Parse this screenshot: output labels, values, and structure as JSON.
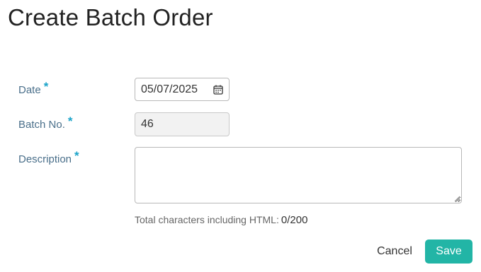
{
  "page": {
    "title": "Create Batch Order"
  },
  "form": {
    "date": {
      "label": "Date",
      "required_marker": "*",
      "value": "05/07/2025",
      "icon": "calendar-icon"
    },
    "batch_no": {
      "label": "Batch No.",
      "required_marker": "*",
      "value": "46"
    },
    "description": {
      "label": "Description",
      "required_marker": "*",
      "value": "",
      "counter_label": "Total characters including HTML:",
      "counter_value": "0/200"
    }
  },
  "actions": {
    "cancel_label": "Cancel",
    "save_label": "Save"
  },
  "colors": {
    "accent": "#22b5a6",
    "required": "#1aa3c9",
    "label": "#4a6f8a"
  }
}
